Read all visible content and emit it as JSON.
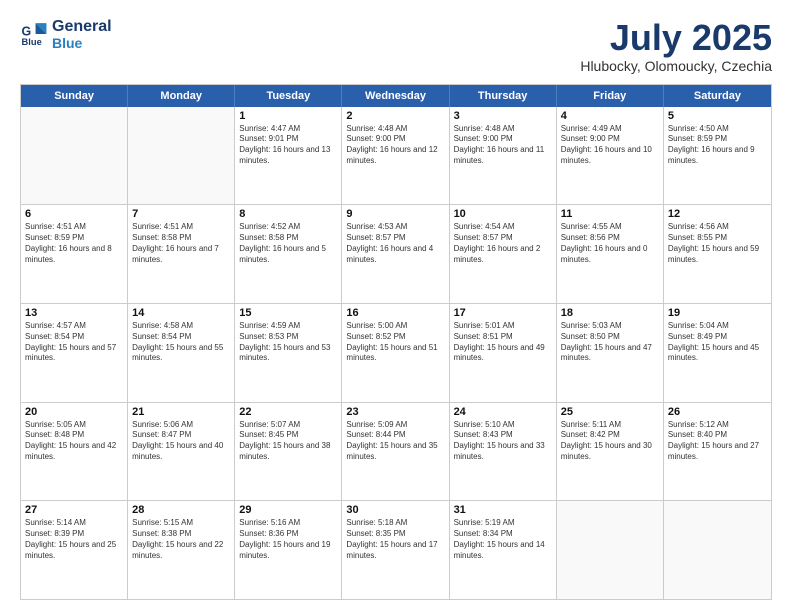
{
  "header": {
    "logo_line1": "General",
    "logo_line2": "Blue",
    "month": "July 2025",
    "location": "Hlubocky, Olomoucky, Czechia"
  },
  "days_of_week": [
    "Sunday",
    "Monday",
    "Tuesday",
    "Wednesday",
    "Thursday",
    "Friday",
    "Saturday"
  ],
  "weeks": [
    [
      {
        "day": "",
        "empty": true
      },
      {
        "day": "",
        "empty": true
      },
      {
        "day": "1",
        "sunrise": "4:47 AM",
        "sunset": "9:01 PM",
        "daylight": "16 hours and 13 minutes."
      },
      {
        "day": "2",
        "sunrise": "4:48 AM",
        "sunset": "9:00 PM",
        "daylight": "16 hours and 12 minutes."
      },
      {
        "day": "3",
        "sunrise": "4:48 AM",
        "sunset": "9:00 PM",
        "daylight": "16 hours and 11 minutes."
      },
      {
        "day": "4",
        "sunrise": "4:49 AM",
        "sunset": "9:00 PM",
        "daylight": "16 hours and 10 minutes."
      },
      {
        "day": "5",
        "sunrise": "4:50 AM",
        "sunset": "8:59 PM",
        "daylight": "16 hours and 9 minutes."
      }
    ],
    [
      {
        "day": "6",
        "sunrise": "4:51 AM",
        "sunset": "8:59 PM",
        "daylight": "16 hours and 8 minutes."
      },
      {
        "day": "7",
        "sunrise": "4:51 AM",
        "sunset": "8:58 PM",
        "daylight": "16 hours and 7 minutes."
      },
      {
        "day": "8",
        "sunrise": "4:52 AM",
        "sunset": "8:58 PM",
        "daylight": "16 hours and 5 minutes."
      },
      {
        "day": "9",
        "sunrise": "4:53 AM",
        "sunset": "8:57 PM",
        "daylight": "16 hours and 4 minutes."
      },
      {
        "day": "10",
        "sunrise": "4:54 AM",
        "sunset": "8:57 PM",
        "daylight": "16 hours and 2 minutes."
      },
      {
        "day": "11",
        "sunrise": "4:55 AM",
        "sunset": "8:56 PM",
        "daylight": "16 hours and 0 minutes."
      },
      {
        "day": "12",
        "sunrise": "4:56 AM",
        "sunset": "8:55 PM",
        "daylight": "15 hours and 59 minutes."
      }
    ],
    [
      {
        "day": "13",
        "sunrise": "4:57 AM",
        "sunset": "8:54 PM",
        "daylight": "15 hours and 57 minutes."
      },
      {
        "day": "14",
        "sunrise": "4:58 AM",
        "sunset": "8:54 PM",
        "daylight": "15 hours and 55 minutes."
      },
      {
        "day": "15",
        "sunrise": "4:59 AM",
        "sunset": "8:53 PM",
        "daylight": "15 hours and 53 minutes."
      },
      {
        "day": "16",
        "sunrise": "5:00 AM",
        "sunset": "8:52 PM",
        "daylight": "15 hours and 51 minutes."
      },
      {
        "day": "17",
        "sunrise": "5:01 AM",
        "sunset": "8:51 PM",
        "daylight": "15 hours and 49 minutes."
      },
      {
        "day": "18",
        "sunrise": "5:03 AM",
        "sunset": "8:50 PM",
        "daylight": "15 hours and 47 minutes."
      },
      {
        "day": "19",
        "sunrise": "5:04 AM",
        "sunset": "8:49 PM",
        "daylight": "15 hours and 45 minutes."
      }
    ],
    [
      {
        "day": "20",
        "sunrise": "5:05 AM",
        "sunset": "8:48 PM",
        "daylight": "15 hours and 42 minutes."
      },
      {
        "day": "21",
        "sunrise": "5:06 AM",
        "sunset": "8:47 PM",
        "daylight": "15 hours and 40 minutes."
      },
      {
        "day": "22",
        "sunrise": "5:07 AM",
        "sunset": "8:45 PM",
        "daylight": "15 hours and 38 minutes."
      },
      {
        "day": "23",
        "sunrise": "5:09 AM",
        "sunset": "8:44 PM",
        "daylight": "15 hours and 35 minutes."
      },
      {
        "day": "24",
        "sunrise": "5:10 AM",
        "sunset": "8:43 PM",
        "daylight": "15 hours and 33 minutes."
      },
      {
        "day": "25",
        "sunrise": "5:11 AM",
        "sunset": "8:42 PM",
        "daylight": "15 hours and 30 minutes."
      },
      {
        "day": "26",
        "sunrise": "5:12 AM",
        "sunset": "8:40 PM",
        "daylight": "15 hours and 27 minutes."
      }
    ],
    [
      {
        "day": "27",
        "sunrise": "5:14 AM",
        "sunset": "8:39 PM",
        "daylight": "15 hours and 25 minutes."
      },
      {
        "day": "28",
        "sunrise": "5:15 AM",
        "sunset": "8:38 PM",
        "daylight": "15 hours and 22 minutes."
      },
      {
        "day": "29",
        "sunrise": "5:16 AM",
        "sunset": "8:36 PM",
        "daylight": "15 hours and 19 minutes."
      },
      {
        "day": "30",
        "sunrise": "5:18 AM",
        "sunset": "8:35 PM",
        "daylight": "15 hours and 17 minutes."
      },
      {
        "day": "31",
        "sunrise": "5:19 AM",
        "sunset": "8:34 PM",
        "daylight": "15 hours and 14 minutes."
      },
      {
        "day": "",
        "empty": true
      },
      {
        "day": "",
        "empty": true
      }
    ]
  ]
}
